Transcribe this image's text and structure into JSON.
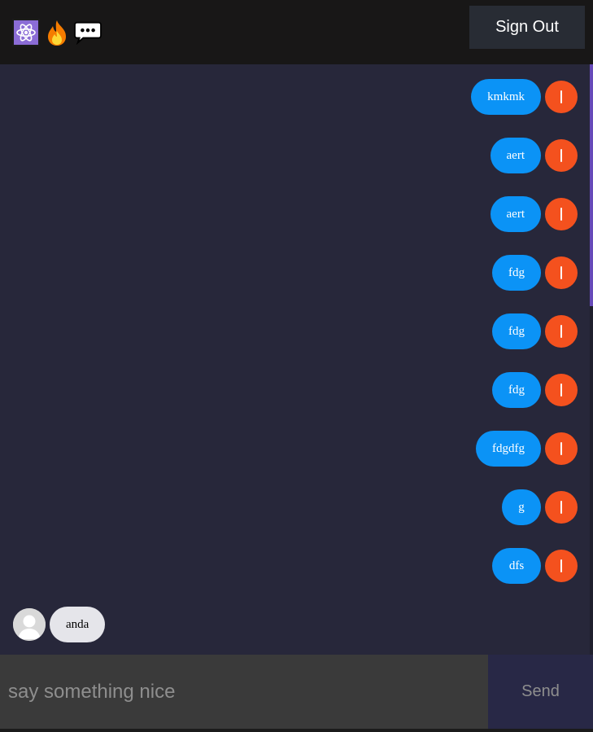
{
  "header": {
    "logo_icons": [
      "atom-icon",
      "fire-icon",
      "speech-bubble-icon"
    ],
    "signout_label": "Sign Out"
  },
  "messages": [
    {
      "type": "sent",
      "text": "kmkmk"
    },
    {
      "type": "sent",
      "text": "aert"
    },
    {
      "type": "sent",
      "text": "aert"
    },
    {
      "type": "sent",
      "text": "fdg"
    },
    {
      "type": "sent",
      "text": "fdg"
    },
    {
      "type": "sent",
      "text": "fdg"
    },
    {
      "type": "sent",
      "text": "fdgdfg"
    },
    {
      "type": "sent",
      "text": "g"
    },
    {
      "type": "sent",
      "text": "dfs"
    },
    {
      "type": "received",
      "text": "anda"
    }
  ],
  "composer": {
    "placeholder": "say something nice",
    "value": "",
    "send_label": "Send"
  },
  "colors": {
    "header_bg": "#181717",
    "chat_bg": "#27273a",
    "sent_bubble": "#0b93f6",
    "received_bubble": "#e5e5ea",
    "sent_avatar": "#f4511e",
    "scrollbar_thumb": "#6649b8"
  }
}
